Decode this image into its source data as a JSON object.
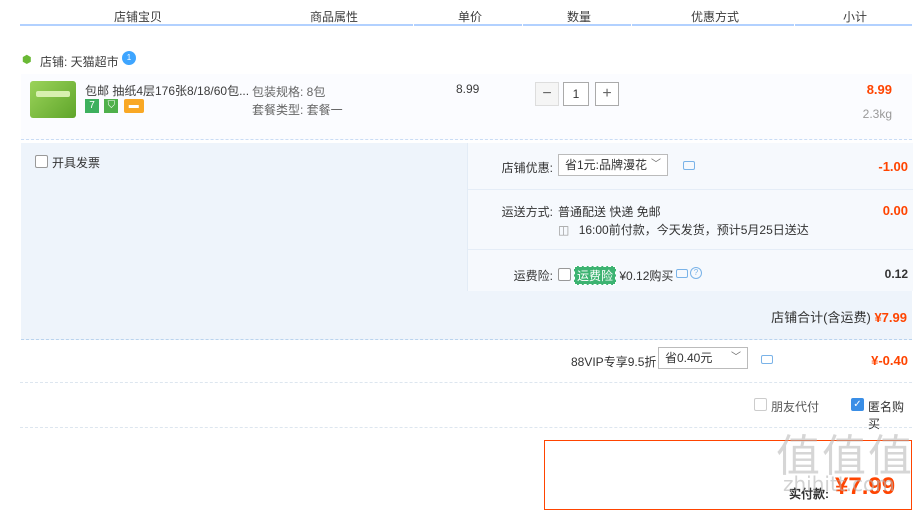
{
  "header": {
    "cols": [
      "店铺宝贝",
      "商品属性",
      "单价",
      "数量",
      "优惠方式",
      "小计"
    ]
  },
  "store": {
    "label": "店铺: 天猫超市",
    "icon": "store-icon",
    "chat_icon": "wangwang-icon",
    "chat_badge": "1"
  },
  "item": {
    "title": "包邮 抽纸4层176张8/18/60包...",
    "badges": [
      "7",
      "",
      ""
    ],
    "props": [
      "包装规格: 8包",
      "套餐类型: 套餐一"
    ],
    "price": "8.99",
    "qty": "1",
    "minus": "−",
    "plus": "+",
    "subtotal": "8.99",
    "weight": "2.3kg"
  },
  "invoice": {
    "label": "开具发票"
  },
  "options": {
    "coupon": {
      "label": "店铺优惠:",
      "value": "省1元:品牌漫花",
      "amount": "-1.00"
    },
    "shipping": {
      "label": "运送方式:",
      "value": "普通配送 快递 免邮",
      "note": "16:00前付款，今天发货，预计5月25日送达",
      "amount": "0.00"
    },
    "insurance": {
      "label": "运费险:",
      "tag": "运费险",
      "price": "¥0.12购买",
      "amount": "0.12"
    }
  },
  "store_total": {
    "label": "店铺合计(含运费)",
    "value": "¥7.99"
  },
  "vip": {
    "label": "88VIP专享9.5折",
    "value": "省0.40元",
    "amount": "¥-0.40"
  },
  "bottom": {
    "friend_pay": "朋友代付",
    "anon_buy": "匿名购买",
    "anon_checked": true
  },
  "pay": {
    "label": "实付款:",
    "value": "¥7.99"
  },
  "watermark": {
    "main": "值值值",
    "sub": "zhihitt.com"
  },
  "colors": {
    "accent": "#ff4400",
    "header_line": "#b2d1ff",
    "options_bg": "#eef4fb"
  }
}
